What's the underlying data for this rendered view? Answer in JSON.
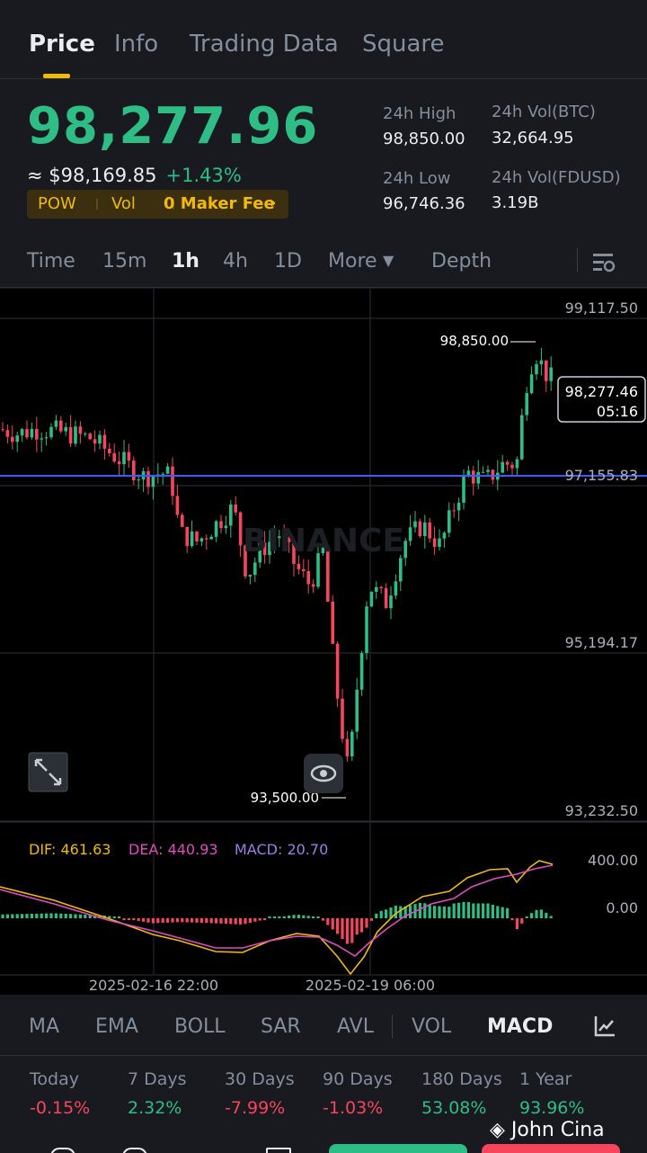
{
  "tabs": [
    "Price",
    "Info",
    "Trading Data",
    "Square"
  ],
  "price": {
    "last": "98,277.96",
    "fiat": "≈ $98,169.85",
    "change": "+1.43%",
    "tags": [
      "POW",
      "Vol",
      "0 Maker Fee"
    ]
  },
  "stats": {
    "high_label": "24h High",
    "high": "98,850.00",
    "low_label": "24h Low",
    "low": "96,746.36",
    "vol_btc_label": "24h Vol(BTC)",
    "vol_btc": "32,664.95",
    "vol_fdusd_label": "24h Vol(FDUSD)",
    "vol_fdusd": "3.19B"
  },
  "intervals": [
    "Time",
    "15m",
    "1h",
    "4h",
    "1D",
    "More",
    "Depth"
  ],
  "active_interval": "1h",
  "chart": {
    "y_labels": [
      "99,117.50",
      "97,155.83",
      "95,194.17",
      "93,232.50"
    ],
    "high_marker": "98,850.00",
    "low_marker": "93,500.00",
    "last_price_box": "98,277.46",
    "countdown": "05:16",
    "watermark": "BINANCE",
    "dif": "DIF: 461.63",
    "dea": "DEA: 440.93",
    "macd": "MACD: 20.70",
    "macd_axis": [
      "400.00",
      "0.00"
    ],
    "x_labels": [
      "2025-02-16 22:00",
      "2025-02-19 06:00"
    ],
    "colors": {
      "up": "#2ebd85",
      "down": "#f6465d",
      "dif": "#f0b90b",
      "dea": "#e04cc0",
      "macd": "#9f7ee6",
      "ref_line": "#3d5afe"
    }
  },
  "indicators": [
    "MA",
    "EMA",
    "BOLL",
    "SAR",
    "AVL",
    "VOL",
    "MACD"
  ],
  "active_indicator": "MACD",
  "performance": [
    {
      "label": "Today",
      "value": "-0.15%"
    },
    {
      "label": "7 Days",
      "value": "2.32%"
    },
    {
      "label": "30 Days",
      "value": "-7.99%"
    },
    {
      "label": "90 Days",
      "value": "-1.03%"
    },
    {
      "label": "180 Days",
      "value": "53.08%"
    },
    {
      "label": "1 Year",
      "value": "93.96%"
    }
  ],
  "user_watermark": "John Cina"
}
